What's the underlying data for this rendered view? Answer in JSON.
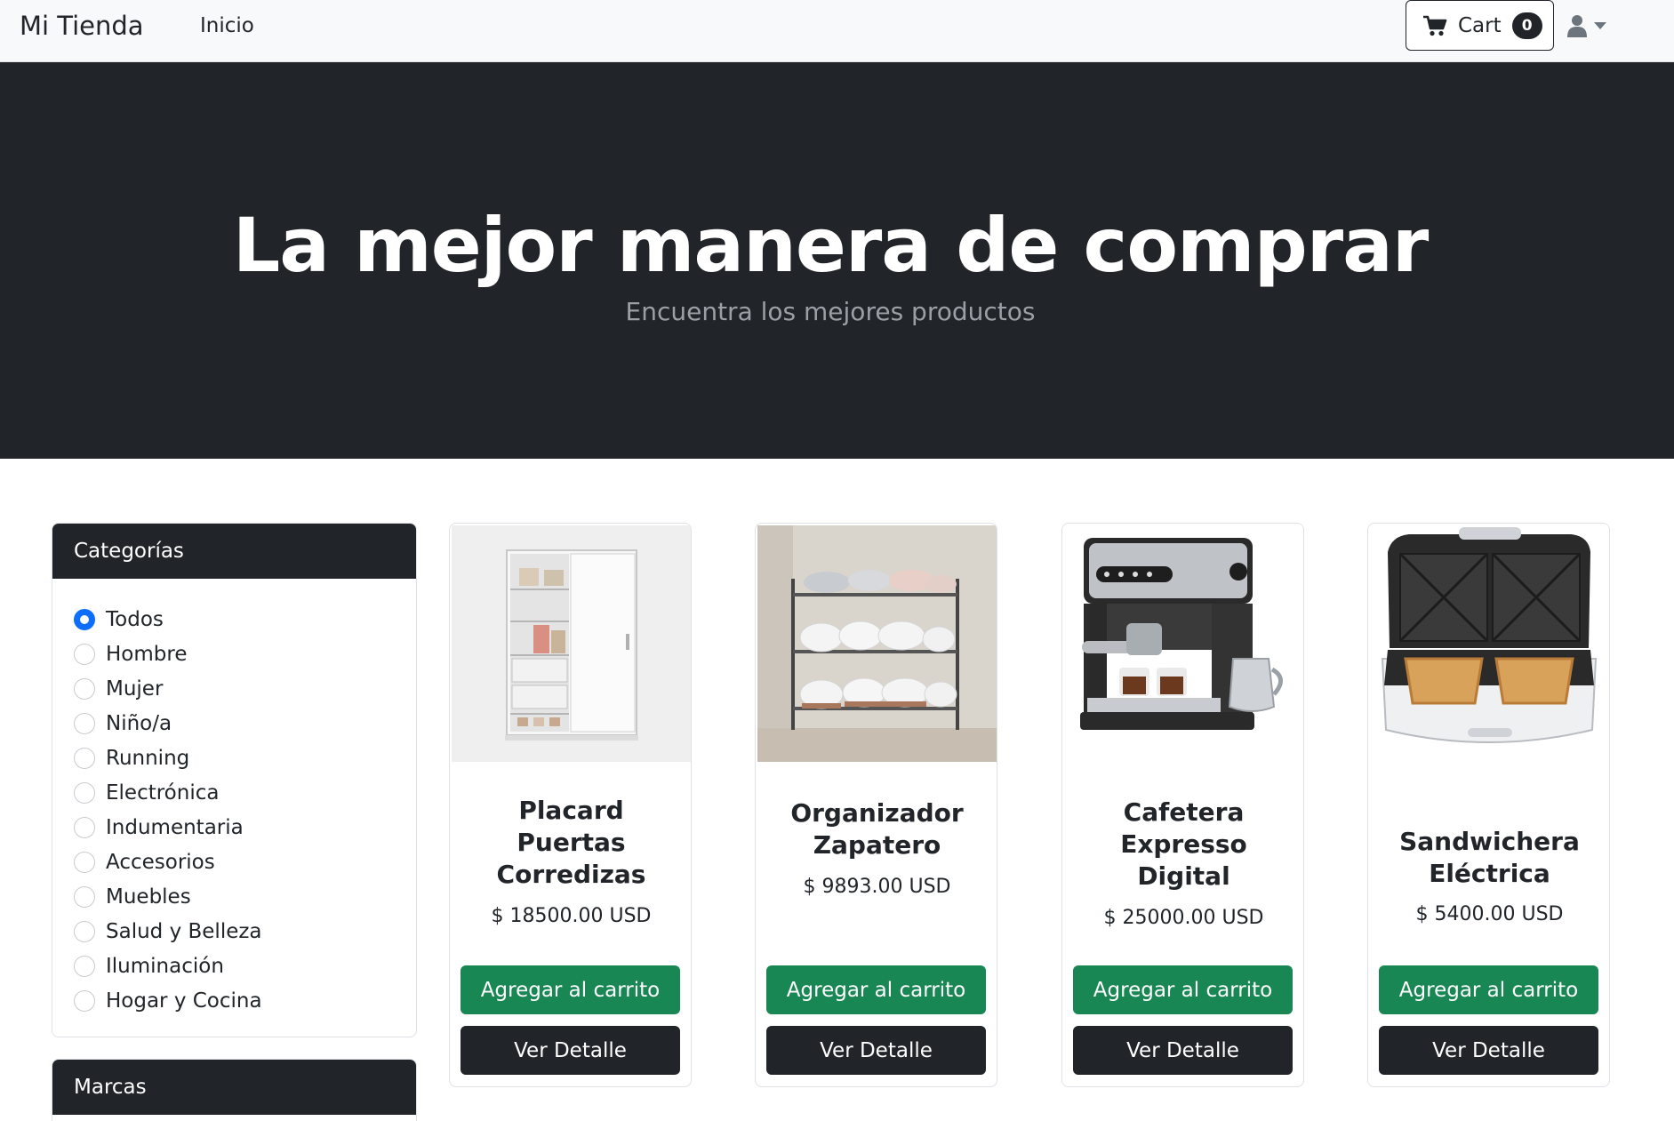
{
  "navbar": {
    "brand": "Mi Tienda",
    "links": [
      "Inicio"
    ],
    "cart_label": "Cart",
    "cart_count": "0",
    "cart_icon": "cart-icon",
    "user_icon": "user-icon"
  },
  "hero": {
    "title": "La mejor manera de comprar",
    "subtitle": "Encuentra los mejores productos"
  },
  "sidebar": {
    "categories_title": "Categorías",
    "categories": [
      {
        "label": "Todos",
        "selected": true
      },
      {
        "label": "Hombre",
        "selected": false
      },
      {
        "label": "Mujer",
        "selected": false
      },
      {
        "label": "Niño/a",
        "selected": false
      },
      {
        "label": "Running",
        "selected": false
      },
      {
        "label": "Electrónica",
        "selected": false
      },
      {
        "label": "Indumentaria",
        "selected": false
      },
      {
        "label": "Accesorios",
        "selected": false
      },
      {
        "label": "Muebles",
        "selected": false
      },
      {
        "label": "Salud y Belleza",
        "selected": false
      },
      {
        "label": "Iluminación",
        "selected": false
      },
      {
        "label": "Hogar y Cocina",
        "selected": false
      }
    ],
    "brands_title": "Marcas"
  },
  "products": [
    {
      "title_lines": [
        "Placard",
        "Puertas",
        "Corredizas"
      ],
      "price": "$ 18500.00 USD",
      "image": "wardrobe-image",
      "add_label": "Agregar al carrito",
      "detail_label": "Ver Detalle"
    },
    {
      "title_lines": [
        "Organizador",
        "Zapatero"
      ],
      "price": "$ 9893.00 USD",
      "image": "shoe-rack-image",
      "add_label": "Agregar al carrito",
      "detail_label": "Ver Detalle"
    },
    {
      "title_lines": [
        "Cafetera",
        "Expresso",
        "Digital"
      ],
      "price": "$ 25000.00 USD",
      "image": "coffee-machine-image",
      "add_label": "Agregar al carrito",
      "detail_label": "Ver Detalle"
    },
    {
      "title_lines": [
        "Sandwichera",
        "Eléctrica"
      ],
      "price": "$ 5400.00 USD",
      "image": "sandwich-maker-image",
      "add_label": "Agregar al carrito",
      "detail_label": "Ver Detalle"
    }
  ],
  "colors": {
    "dark": "#212529",
    "success": "#198754",
    "primary": "#0d6efd",
    "navbar_bg": "#f8f9fa"
  }
}
